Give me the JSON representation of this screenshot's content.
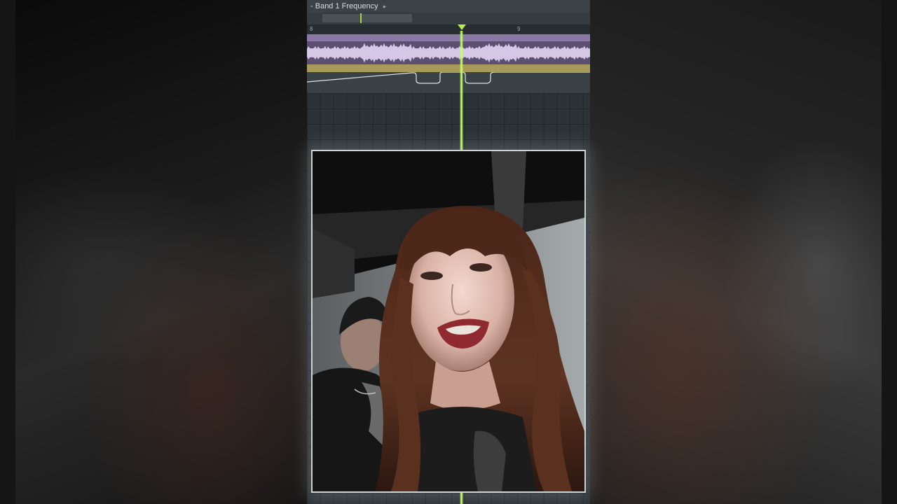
{
  "window": {
    "title": "Band 1 Frequency",
    "title_prefix": "-",
    "title_suffix": "▸"
  },
  "timeline": {
    "ruler_marks": [
      "8",
      "9"
    ],
    "playhead_color": "#c8ff6a"
  },
  "colors": {
    "clip_header": "#8a7aa3",
    "waveform": "#d5c8e6",
    "automation_clip": "#a89a5a",
    "accent_green": "#a5d64a"
  },
  "video": {
    "icon": "webcam-overlay"
  }
}
